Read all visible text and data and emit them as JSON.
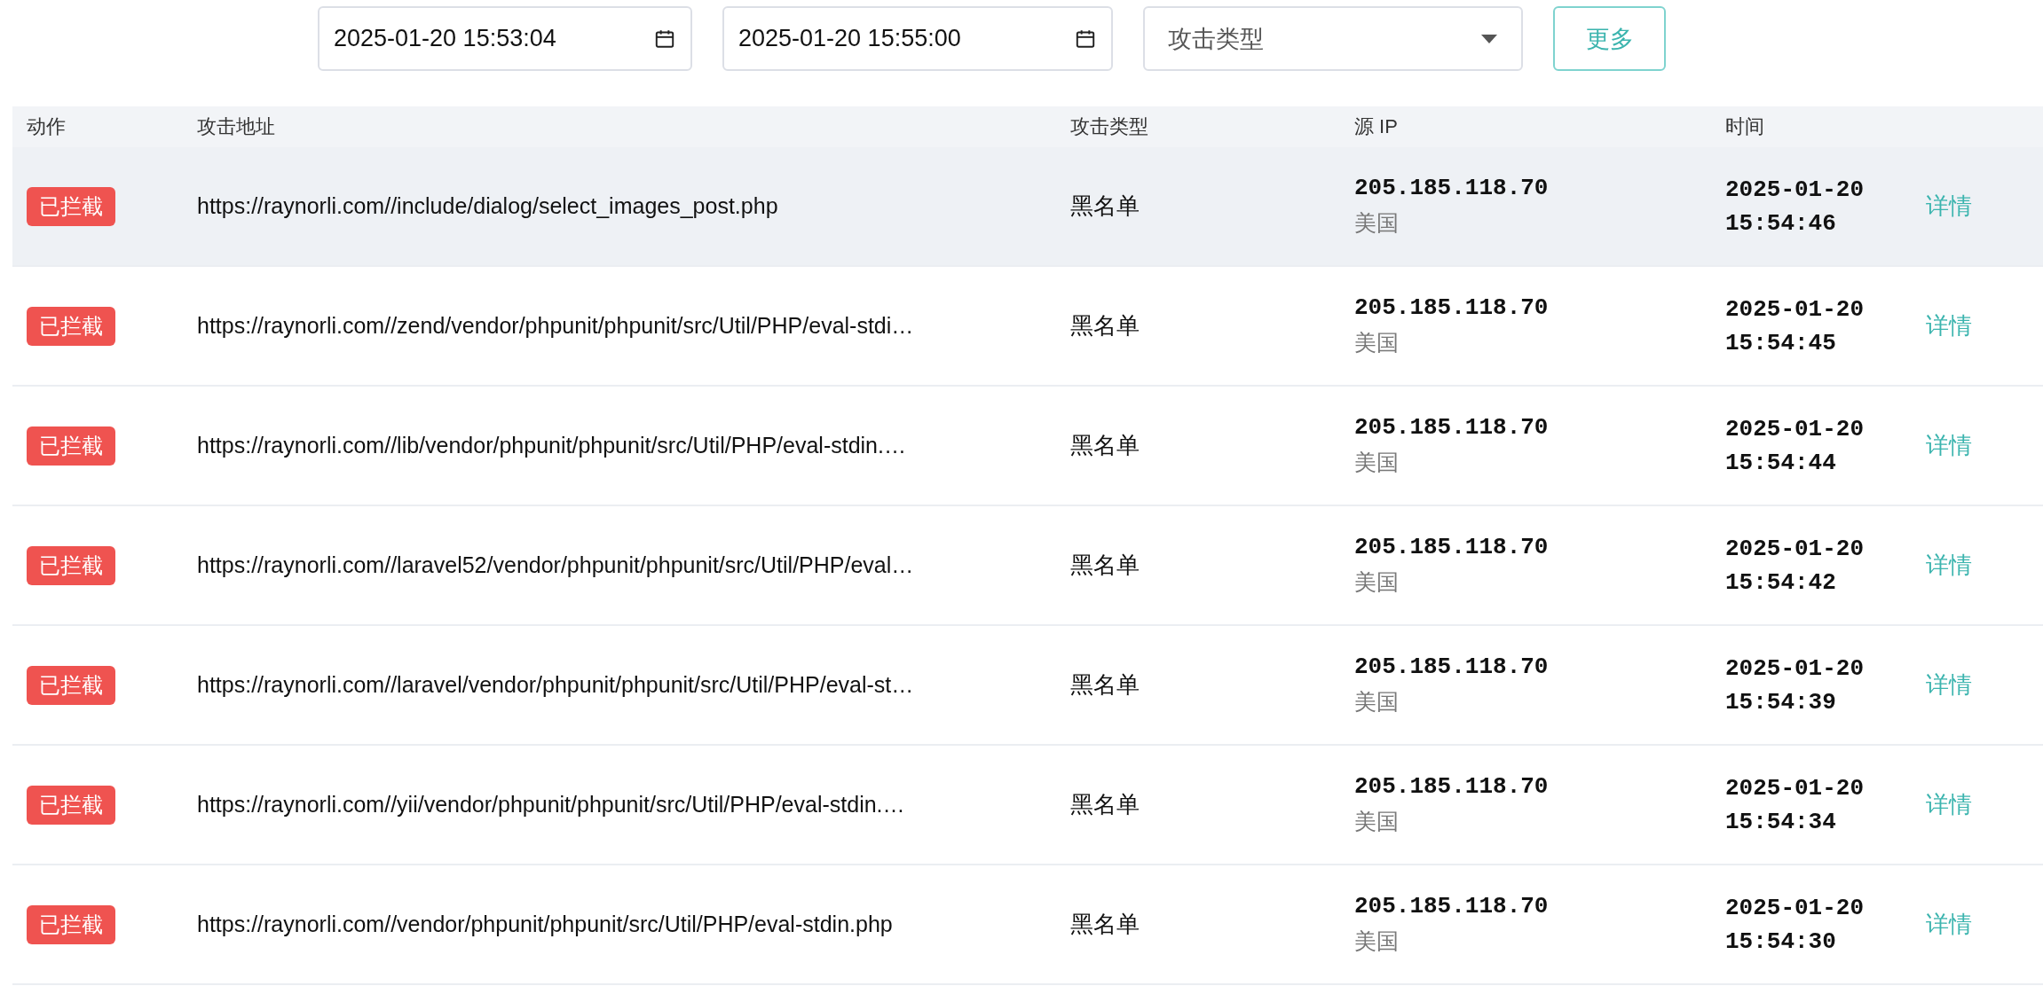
{
  "filters": {
    "start_time": "2025-01-20 15:53:04",
    "end_time": "2025-01-20 15:55:00",
    "attack_type": {
      "placeholder": "攻击类型"
    },
    "more_button": "更多"
  },
  "table": {
    "columns": [
      "动作",
      "攻击地址",
      "攻击类型",
      "源 IP",
      "时间"
    ],
    "rows": [
      {
        "selected": true,
        "action": "已拦截",
        "url": "https://raynorli.com//include/dialog/select_images_post.php",
        "type": "黑名单",
        "ip": "205.185.118.70",
        "region": "美国",
        "date": "2025-01-20",
        "time": "15:54:46",
        "link": "详情"
      },
      {
        "selected": false,
        "action": "已拦截",
        "url": "https://raynorli.com//zend/vendor/phpunit/phpunit/src/Util/PHP/eval-stdi…",
        "type": "黑名单",
        "ip": "205.185.118.70",
        "region": "美国",
        "date": "2025-01-20",
        "time": "15:54:45",
        "link": "详情"
      },
      {
        "selected": false,
        "action": "已拦截",
        "url": "https://raynorli.com//lib/vendor/phpunit/phpunit/src/Util/PHP/eval-stdin.…",
        "type": "黑名单",
        "ip": "205.185.118.70",
        "region": "美国",
        "date": "2025-01-20",
        "time": "15:54:44",
        "link": "详情"
      },
      {
        "selected": false,
        "action": "已拦截",
        "url": "https://raynorli.com//laravel52/vendor/phpunit/phpunit/src/Util/PHP/eval…",
        "type": "黑名单",
        "ip": "205.185.118.70",
        "region": "美国",
        "date": "2025-01-20",
        "time": "15:54:42",
        "link": "详情"
      },
      {
        "selected": false,
        "action": "已拦截",
        "url": "https://raynorli.com//laravel/vendor/phpunit/phpunit/src/Util/PHP/eval-st…",
        "type": "黑名单",
        "ip": "205.185.118.70",
        "region": "美国",
        "date": "2025-01-20",
        "time": "15:54:39",
        "link": "详情"
      },
      {
        "selected": false,
        "action": "已拦截",
        "url": "https://raynorli.com//yii/vendor/phpunit/phpunit/src/Util/PHP/eval-stdin.…",
        "type": "黑名单",
        "ip": "205.185.118.70",
        "region": "美国",
        "date": "2025-01-20",
        "time": "15:54:34",
        "link": "详情"
      },
      {
        "selected": false,
        "action": "已拦截",
        "url": "https://raynorli.com//vendor/phpunit/phpunit/src/Util/PHP/eval-stdin.php",
        "type": "黑名单",
        "ip": "205.185.118.70",
        "region": "美国",
        "date": "2025-01-20",
        "time": "15:54:30",
        "link": "详情"
      }
    ]
  }
}
